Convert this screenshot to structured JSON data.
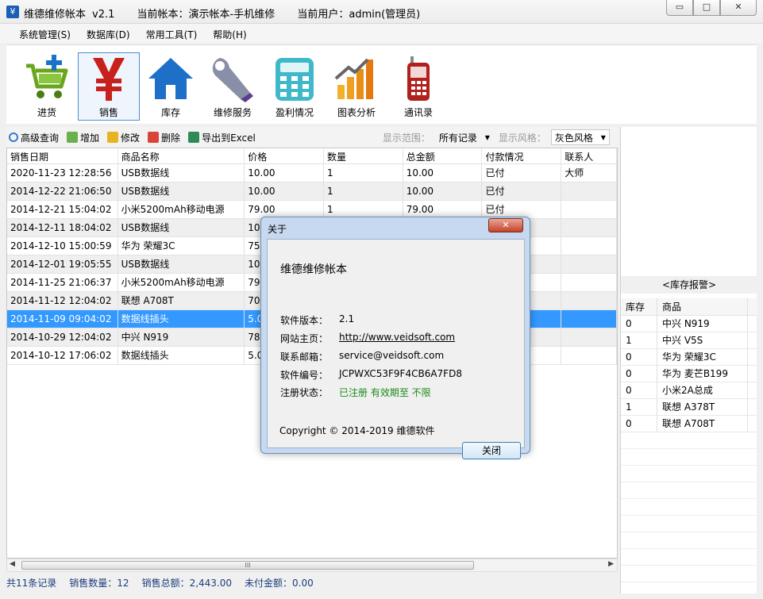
{
  "window": {
    "app_name": "维德维修帐本",
    "version": "v2.1",
    "account": "当前帐本：演示帐本-手机维修",
    "user": "当前用户：admin(管理员)",
    "controls": {
      "minimize": "▭",
      "maximize": "□",
      "close": "✕"
    }
  },
  "menu": [
    "系统管理(S)",
    "数据库(D)",
    "常用工具(T)",
    "帮助(H)"
  ],
  "toolbar": [
    {
      "label": "进货",
      "icon": "cart-add-icon"
    },
    {
      "label": "销售",
      "icon": "yen-icon",
      "active": true
    },
    {
      "label": "库存",
      "icon": "house-icon"
    },
    {
      "label": "维修服务",
      "icon": "wrench-icon"
    },
    {
      "label": "盈利情况",
      "icon": "calculator-icon"
    },
    {
      "label": "图表分析",
      "icon": "bar-chart-icon"
    },
    {
      "label": "通讯录",
      "icon": "phone-icon"
    }
  ],
  "subtoolbar": {
    "query": "高级查询",
    "add": "增加",
    "edit": "修改",
    "delete": "删除",
    "export": "导出到Excel",
    "range_label": "显示范围：",
    "range_value": "所有记录",
    "style_label": "显示风格：",
    "style_value": "灰色风格"
  },
  "grid": {
    "headers": [
      "销售日期",
      "商品名称",
      "价格",
      "数量",
      "总金额",
      "付款情况",
      "联系人"
    ],
    "rows": [
      [
        "2020-11-23 12:28:56",
        "USB数据线",
        "10.00",
        "1",
        "10.00",
        "已付",
        "大师"
      ],
      [
        "2014-12-22 21:06:50",
        "USB数据线",
        "10.00",
        "1",
        "10.00",
        "已付",
        ""
      ],
      [
        "2014-12-21 15:04:02",
        "小米5200mAh移动电源",
        "79.00",
        "1",
        "79.00",
        "已付",
        ""
      ],
      [
        "2014-12-11 18:04:02",
        "USB数据线",
        "10.",
        "",
        "",
        "",
        ""
      ],
      [
        "2014-12-10 15:00:59",
        "华为 荣耀3C",
        "750",
        "",
        "",
        "",
        ""
      ],
      [
        "2014-12-01 19:05:55",
        "USB数据线",
        "10.",
        "",
        "",
        "",
        ""
      ],
      [
        "2014-11-25 21:06:37",
        "小米5200mAh移动电源",
        "79.",
        "",
        "",
        "",
        ""
      ],
      [
        "2014-11-12 12:04:02",
        "联想 A708T",
        "700",
        "",
        "",
        "",
        ""
      ],
      [
        "2014-11-09 09:04:02",
        "数据线插头",
        "5.0",
        "",
        "",
        "",
        ""
      ],
      [
        "2014-10-29 12:04:02",
        "中兴 N919",
        "780",
        "",
        "",
        "",
        ""
      ],
      [
        "2014-10-12 17:06:02",
        "数据线插头",
        "5.0",
        "",
        "",
        "",
        ""
      ]
    ],
    "selected_row": 8
  },
  "status": {
    "total": "共11条记录",
    "qty": "销售数量：12",
    "amount": "销售总额：2,443.00",
    "unpaid": "未付金额：0.00"
  },
  "stock": {
    "title": "<库存报警>",
    "headers": [
      "库存",
      "商品"
    ],
    "rows": [
      [
        "0",
        "中兴 N919"
      ],
      [
        "1",
        "中兴 V5S"
      ],
      [
        "0",
        "华为 荣耀3C"
      ],
      [
        "0",
        "华为 麦芒B199"
      ],
      [
        "0",
        "小米2A总成"
      ],
      [
        "1",
        "联想 A378T"
      ],
      [
        "0",
        "联想 A708T"
      ]
    ]
  },
  "dialog": {
    "title": "关于",
    "close_x": "✕",
    "name": "维德维修帐本",
    "version_label": "软件版本：",
    "version": "2.1",
    "site_label": "网站主页：",
    "site": "http://www.veidsoft.com",
    "email_label": "联系邮箱：",
    "email": "service@veidsoft.com",
    "serial_label": "软件编号：",
    "serial": "JCPWXC53F9F4CB6A7FD8",
    "reg_label": "注册状态：",
    "reg": "已注册 有效期至 不限",
    "copyright": "Copyright © 2014-2019 维德软件",
    "close_btn": "关闭"
  }
}
